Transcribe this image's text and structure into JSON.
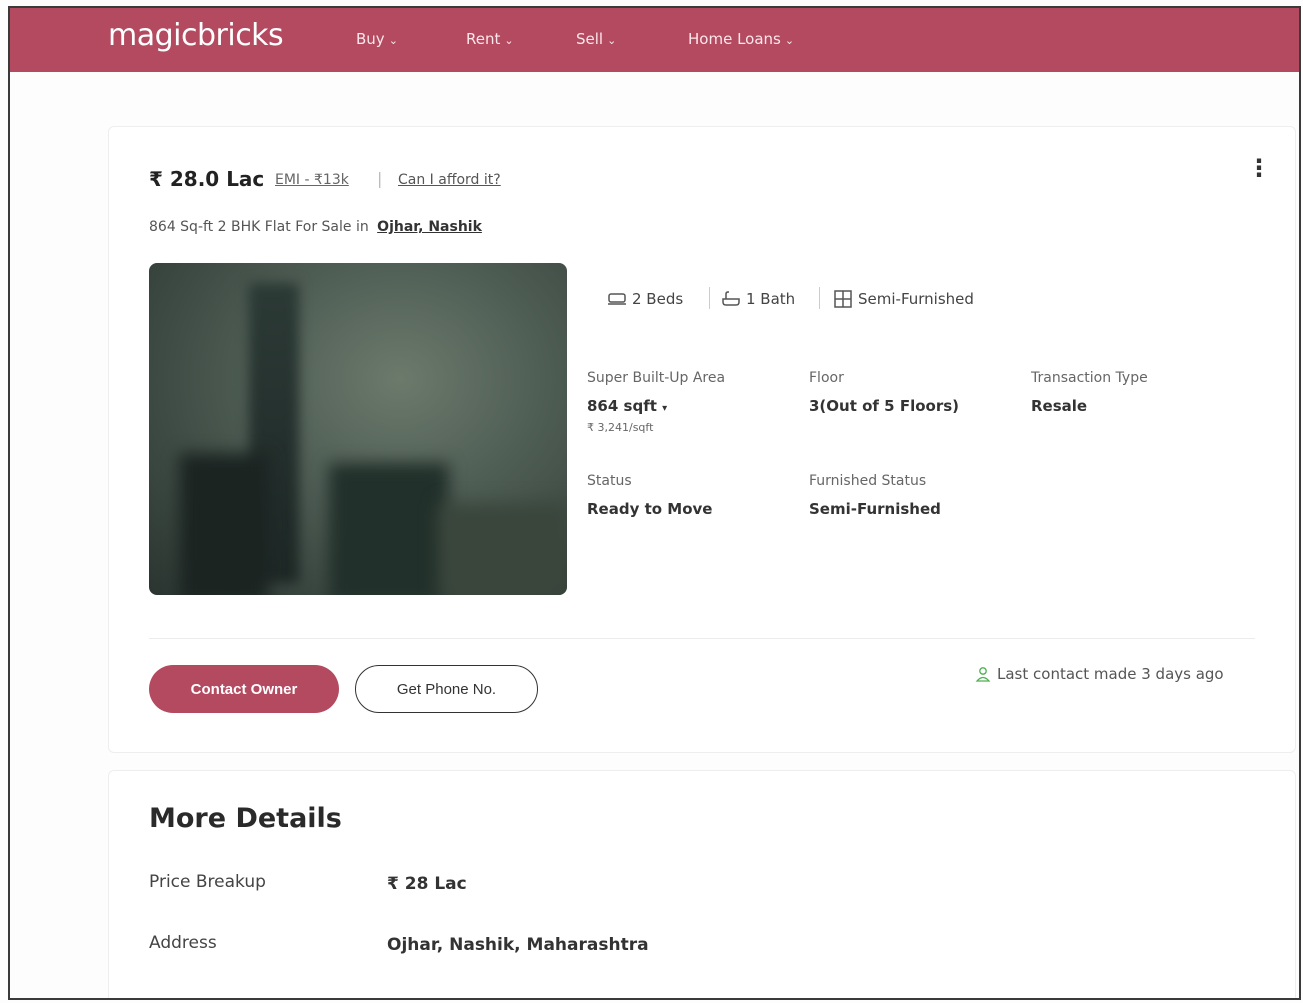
{
  "nav": {
    "logo": "magicbricks",
    "links": [
      {
        "label": "Buy"
      },
      {
        "label": "Rent"
      },
      {
        "label": "Sell"
      },
      {
        "label": "Home Loans"
      }
    ]
  },
  "listing": {
    "price": "₹ 28.0 Lac",
    "emi": "EMI - ₹13k",
    "afford": "Can I afford it?",
    "subtitle": "864 Sq-ft 2 BHK Flat For Sale in",
    "location": "Ojhar, Nashik",
    "amenities": {
      "beds": "2 Beds",
      "bath": "1 Bath",
      "furnishing": "Semi-Furnished"
    },
    "details": {
      "area_label": "Super Built-Up Area",
      "area_value": "864 sqft",
      "area_rate": "₹ 3,241/sqft",
      "floor_label": "Floor",
      "floor_value": "3(Out of 5 Floors)",
      "transaction_label": "Transaction Type",
      "transaction_value": "Resale",
      "status_label": "Status",
      "status_value": "Ready to Move",
      "furnished_label": "Furnished Status",
      "furnished_value": "Semi-Furnished"
    },
    "contact_owner": "Contact Owner",
    "get_phone": "Get Phone No.",
    "last_contact": "Last contact made 3 days ago"
  },
  "more_details": {
    "title": "More Details",
    "price_breakup_label": "Price Breakup",
    "price_breakup_value": "₹ 28 Lac",
    "address_label": "Address",
    "address_value": "Ojhar, Nashik, Maharashtra"
  },
  "colors": {
    "brand": "#b34a60"
  }
}
